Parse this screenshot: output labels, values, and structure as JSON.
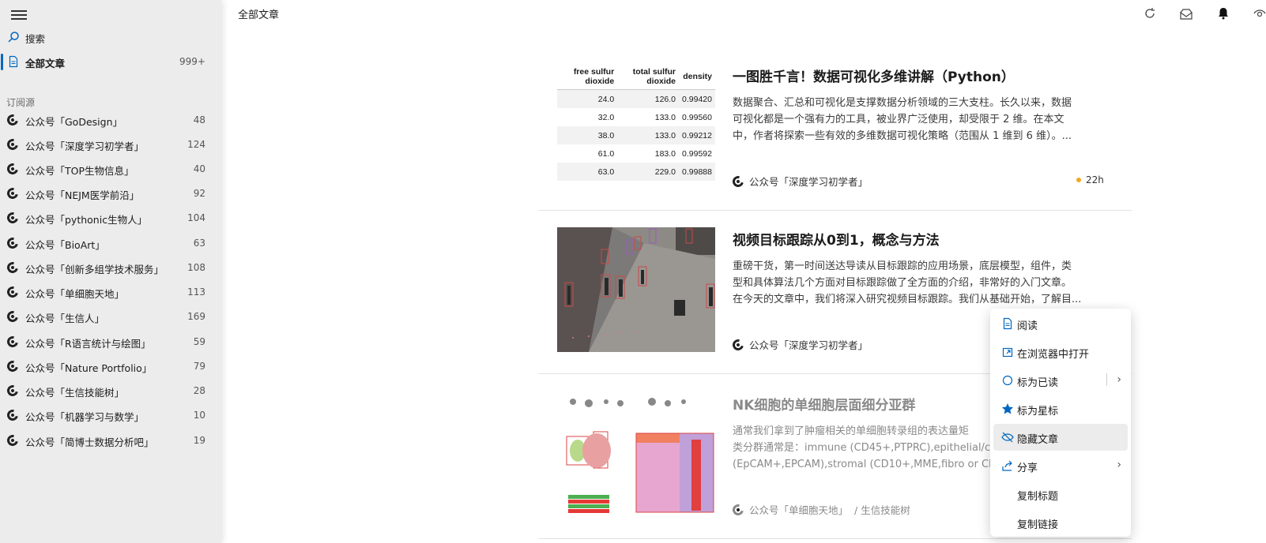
{
  "sidebar": {
    "search_label": "搜索",
    "all_articles": {
      "label": "全部文章",
      "count": "999+"
    },
    "section_label": "订阅源",
    "feeds": [
      {
        "label": "公众号「GoDesign」",
        "count": "48"
      },
      {
        "label": "公众号「深度学习初学者」",
        "count": "124"
      },
      {
        "label": "公众号「TOP生物信息」",
        "count": "40"
      },
      {
        "label": "公众号「NEJM医学前沿」",
        "count": "92"
      },
      {
        "label": "公众号「pythonic生物人」",
        "count": "104"
      },
      {
        "label": "公众号「BioArt」",
        "count": "63"
      },
      {
        "label": "公众号「创新多组学技术服务」",
        "count": "108"
      },
      {
        "label": "公众号「单细胞天地」",
        "count": "113"
      },
      {
        "label": "公众号「生信人」",
        "count": "169"
      },
      {
        "label": "公众号「R语言统计与绘图」",
        "count": "59"
      },
      {
        "label": "公众号「Nature Portfolio」",
        "count": "79"
      },
      {
        "label": "公众号「生信技能树」",
        "count": "28"
      },
      {
        "label": "公众号「机器学习与数学」",
        "count": "10"
      },
      {
        "label": "公众号「简博士数据分析吧」",
        "count": "19"
      }
    ]
  },
  "main": {
    "title": "全部文章",
    "articles": [
      {
        "title": "一图胜千言！数据可视化多维讲解（Python）",
        "desc_lines": [
          "数据聚合、汇总和可视化是支撑数据分析领域的三大支柱。长久以来，数据",
          "可视化都是一个强有力的工具，被业界广泛使用，却受限于 2 维。在本文",
          "中，作者将探索一些有效的多维数据可视化策略（范围从 1 维到 6 维）。..."
        ],
        "source": "公众号「深度学习初学者」",
        "time": "22h",
        "thumb_table": {
          "headers": [
            "free sulfur dioxide",
            "total sulfur dioxide",
            "density"
          ],
          "rows": [
            [
              "24.0",
              "126.0",
              "0.99420"
            ],
            [
              "32.0",
              "133.0",
              "0.99560"
            ],
            [
              "38.0",
              "133.0",
              "0.99212"
            ],
            [
              "61.0",
              "183.0",
              "0.99592"
            ],
            [
              "63.0",
              "229.0",
              "0.99888"
            ]
          ]
        }
      },
      {
        "title": "视频目标跟踪从0到1，概念与方法",
        "desc_lines": [
          "重磅干货，第一时间送达导读从目标跟踪的应用场景，底层模型，组件，类",
          "型和具体算法几个方面对目标跟踪做了全方面的介绍，非常好的入门文章。",
          "在今天的文章中，我们将深入研究视频目标跟踪。我们从基础开始，了解目..."
        ],
        "source": "公众号「深度学习初学者」"
      },
      {
        "title": "NK细胞的单细胞层面细分亚群",
        "desc_lines": [
          "通常我们拿到了肿瘤相关的单细胞转录组的表达量矩",
          "类分群通常是：immune (CD45+,PTPRC),epithelial/ca",
          "(EpCAM+,EPCAM),stromal (CD10+,MME,fibro or CD"
        ],
        "source": "公众号「单细胞天地」",
        "source_extra": "/ 生信技能树"
      }
    ]
  },
  "context_menu": [
    {
      "label": "阅读",
      "icon": "document-icon"
    },
    {
      "label": "在浏览器中打开",
      "icon": "open-external-icon"
    },
    {
      "label": "标为已读",
      "icon": "circle-icon",
      "submenu": true
    },
    {
      "label": "标为星标",
      "icon": "star-icon"
    },
    {
      "label": "隐藏文章",
      "icon": "eye-off-icon",
      "hover": true
    },
    {
      "label": "分享",
      "icon": "share-icon",
      "submenu": true
    },
    {
      "label": "复制标题",
      "icon": ""
    },
    {
      "label": "复制链接",
      "icon": ""
    }
  ],
  "colors": {
    "accent": "#0067c0",
    "unread_dot": "#f4a622",
    "sidebar_bg": "#ececec"
  }
}
